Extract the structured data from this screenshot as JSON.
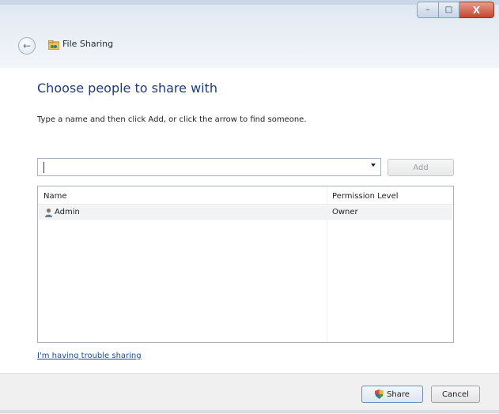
{
  "window": {
    "title": "File Sharing",
    "controls": {
      "minimize": "–",
      "maximize": "□",
      "close": "X"
    }
  },
  "content": {
    "heading": "Choose people to share with",
    "instructions": "Type a name and then click Add, or click the arrow to find someone.",
    "name_input": {
      "value": "",
      "placeholder": ""
    },
    "add_label": "Add",
    "list": {
      "columns": [
        "Name",
        "Permission Level"
      ],
      "rows": [
        {
          "name": "Admin",
          "permission": "Owner",
          "icon": "user-icon"
        }
      ]
    },
    "help_link": "I'm having trouble sharing"
  },
  "footer": {
    "share_label": "Share",
    "cancel_label": "Cancel"
  },
  "colors": {
    "heading": "#1e3a78",
    "link": "#1a4fa0",
    "close_button": "#c6452f"
  }
}
